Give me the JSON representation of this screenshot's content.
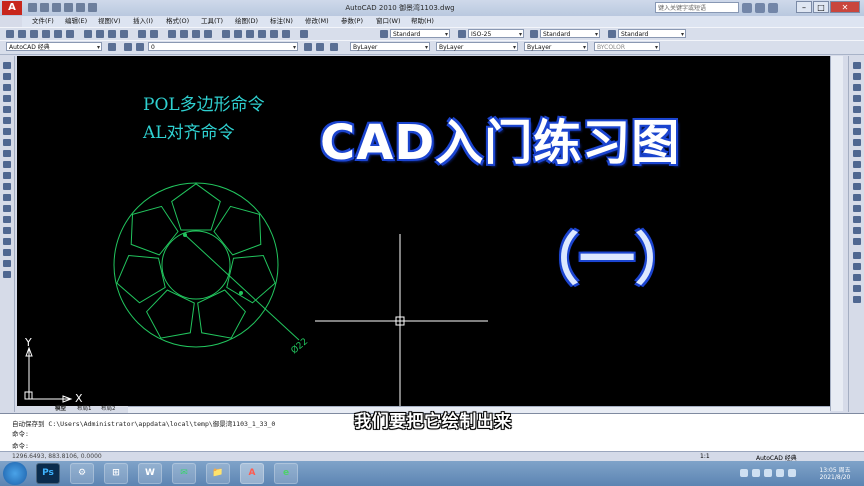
{
  "titlebar": {
    "app_logo": "A",
    "title": "AutoCAD 2010    御景湾1103.dwg",
    "search_placeholder": "键入关键字或短语",
    "minimize": "–",
    "maximize": "□",
    "close": "✕"
  },
  "menu": {
    "items": [
      "文件(F)",
      "编辑(E)",
      "视图(V)",
      "插入(I)",
      "格式(O)",
      "工具(T)",
      "绘图(D)",
      "标注(N)",
      "修改(M)",
      "参数(P)",
      "窗口(W)",
      "帮助(H)"
    ]
  },
  "toolbar1": {
    "text_style": "Standard",
    "dim_style": "ISO-25",
    "table_style": "Standard",
    "mleader_style": "Standard"
  },
  "toolbar2": {
    "workspace": "AutoCAD 经典",
    "layer": "0",
    "color": "ByLayer",
    "linetype": "ByLayer",
    "lineweight": "ByLayer",
    "plotstyle": "BYCOLOR"
  },
  "drawing": {
    "note_line1": "POL多边形命令",
    "note_line2": "AL对齐命令",
    "dimension": "Ø22",
    "ucs_x": "X",
    "ucs_y": "Y",
    "line_color": "#22c55e",
    "note_color": "#2fd0d0"
  },
  "overlay": {
    "title": "CAD入门练习图",
    "subtitle": "（一）",
    "caption": "我们要把它绘制出来",
    "title_outline_color": "#1e46d3"
  },
  "tabs": {
    "model": "模型",
    "layout1": "布局1",
    "layout2": "布局2"
  },
  "command": {
    "line1": "自动保存到 C:\\Users\\Administrator\\appdata\\local\\temp\\御景湾1103_1_33_0",
    "line2": "命令:",
    "line3": "命令:"
  },
  "statusbar": {
    "coords": "1296.6493, 883.8106, 0.0000",
    "scale": "1:1",
    "workspace": "AutoCAD 经典"
  },
  "taskbar": {
    "apps": [
      "Ps",
      "⚙",
      "⊞",
      "W",
      "✉",
      "📁",
      "A",
      "e"
    ],
    "time": "13:05 周五",
    "date": "2021/8/20"
  }
}
